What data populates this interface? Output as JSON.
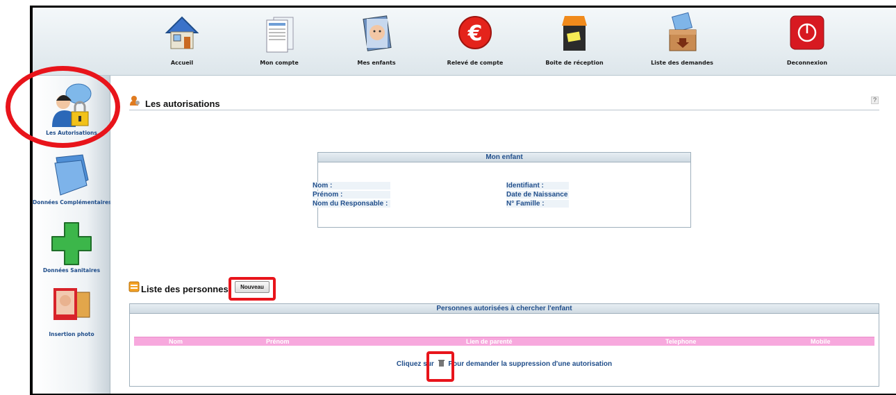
{
  "topnav": [
    {
      "label": "Accueil",
      "icon": "house-icon"
    },
    {
      "label": "Mon compte",
      "icon": "documents-icon"
    },
    {
      "label": "Mes enfants",
      "icon": "child-photo-icon"
    },
    {
      "label": "Relevé de compte",
      "icon": "euro-icon"
    },
    {
      "label": "Boite de réception",
      "icon": "inbox-icon"
    },
    {
      "label": "Liste des demandes",
      "icon": "box-icon"
    },
    {
      "label": "Deconnexion",
      "icon": "power-icon"
    }
  ],
  "sidebar": [
    {
      "label": "Les Autorisations",
      "icon": "user-lock-icon"
    },
    {
      "label": "Données Complémentaires",
      "icon": "folder-icon"
    },
    {
      "label": "Données Sanitaires",
      "icon": "green-cross-icon"
    },
    {
      "label": "Insertion photo",
      "icon": "photo-icon"
    }
  ],
  "main": {
    "title": "Les autorisations",
    "help": "?",
    "child_panel": {
      "header": "Mon enfant",
      "left": [
        "Nom :",
        "Prénom :",
        "Nom du Responsable :"
      ],
      "right": [
        "Identifiant :",
        "Date de Naissance :",
        "N° Famille :"
      ]
    },
    "persons": {
      "title": "Liste des personnes",
      "new_button": "Nouveau",
      "panel_header": "Personnes autorisées à chercher l'enfant",
      "columns": [
        "Nom",
        "Prénom",
        "Lien de parenté",
        "Telephone",
        "Mobile"
      ],
      "hint_before": "Cliquez sur",
      "hint_after": "Pour demander la suppression d'une autorisation"
    }
  },
  "colors": {
    "accent": "#1f4d8a",
    "table_header": "#f7a8dd",
    "highlight": "#e8141b"
  }
}
